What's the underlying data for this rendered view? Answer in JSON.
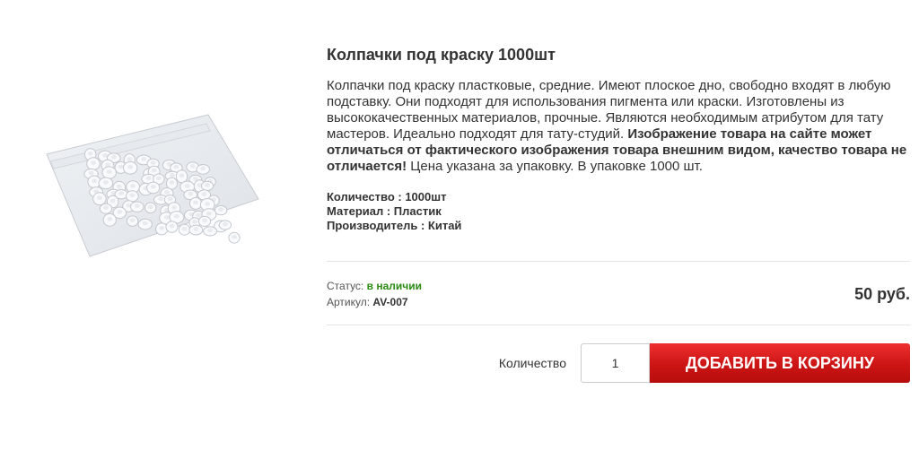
{
  "product": {
    "image_alt": "Колпачки под краску 1000шт",
    "title": "Колпачки под краску 1000шт",
    "description": {
      "part1": "Колпачки под краску пластковые, средние. Имеют плоское дно, свободно входят в любую подставку. Они подходят для использования пигмента или краски. Изготовлены из высококачественных материалов, прочные. Являются необходимым атрибутом для тату мастеров. Идеально подходят для тату-студий. ",
      "bold": "Изображение товара на сайте может отличаться от фактического изображения товара внешним видом, качество товара не отличается!",
      "part2": " Цена указана за упаковку. В упаковке 1000 шт."
    },
    "specs": [
      "Количество : 1000шт",
      "Материал : Пластик",
      "Производитель : Китай"
    ],
    "status_label": "Статус:",
    "status_value": "в наличии",
    "sku_label": "Артикул:",
    "sku_value": "AV-007",
    "price": "50 руб.",
    "quantity_label": "Количество",
    "quantity_value": "1",
    "add_to_cart_label": "Добавить в корзину"
  },
  "colors": {
    "in_stock": "#2a8a12",
    "cart_button": "#cc1414"
  }
}
